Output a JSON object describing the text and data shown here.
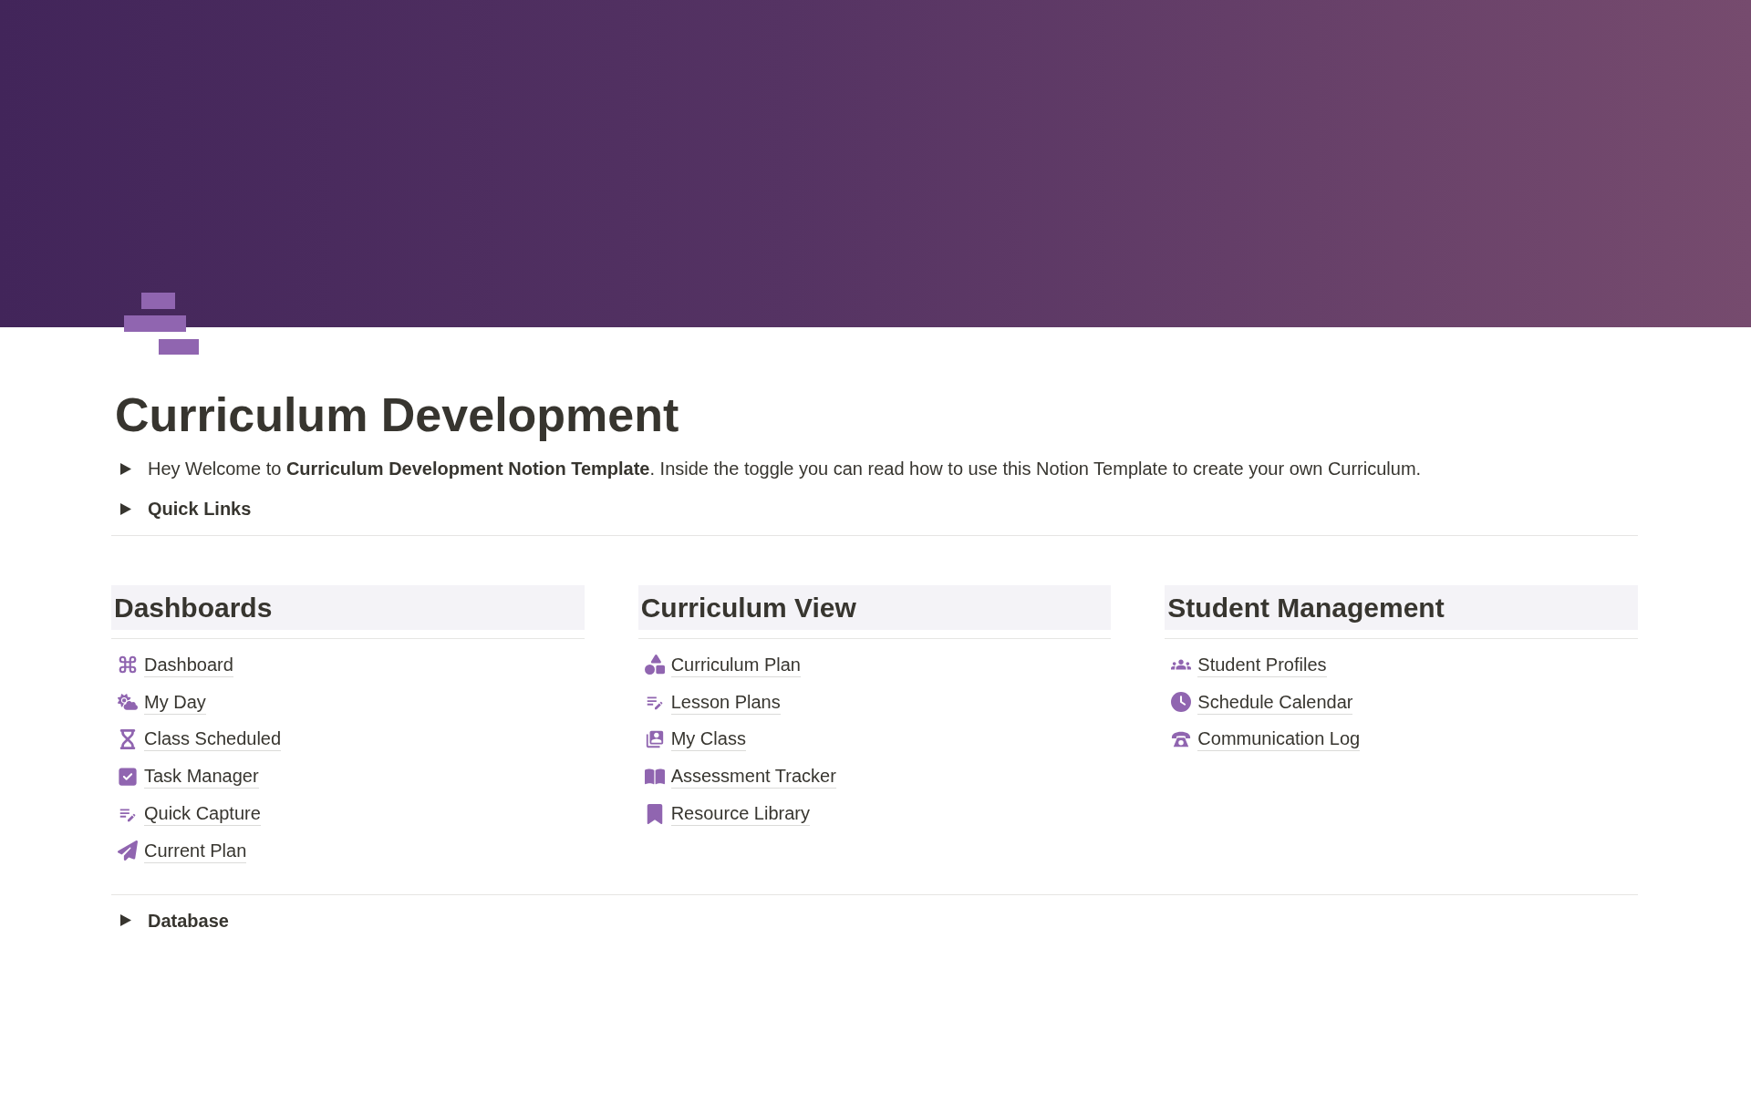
{
  "page": {
    "title": "Curriculum Development"
  },
  "intro_toggles": [
    {
      "kind": "paragraph",
      "text": "Hey Welcome to **Curriculum Development Notion Template**. Inside the toggle you can read how to use this Notion Template to create your own Curriculum.",
      "expanded": false
    },
    {
      "kind": "label",
      "text": "Quick Links",
      "expanded": false
    }
  ],
  "sections": [
    {
      "heading": "Dashboards",
      "links": [
        {
          "label": "Dashboard"
        },
        {
          "label": "My Day"
        },
        {
          "label": "Class Scheduled"
        },
        {
          "label": "Task Manager"
        },
        {
          "label": "Quick Capture"
        },
        {
          "label": "Current Plan"
        }
      ]
    },
    {
      "heading": "Curriculum View",
      "links": [
        {
          "label": "Curriculum Plan"
        },
        {
          "label": "Lesson Plans"
        },
        {
          "label": "My Class"
        },
        {
          "label": "Assessment Tracker"
        },
        {
          "label": "Resource Library"
        }
      ]
    },
    {
      "heading": "Student Management",
      "links": [
        {
          "label": "Student Profiles"
        },
        {
          "label": "Schedule Calendar"
        },
        {
          "label": "Communication Log"
        }
      ]
    }
  ],
  "footer_toggles": [
    {
      "kind": "label",
      "text": "Database",
      "expanded": false
    }
  ]
}
